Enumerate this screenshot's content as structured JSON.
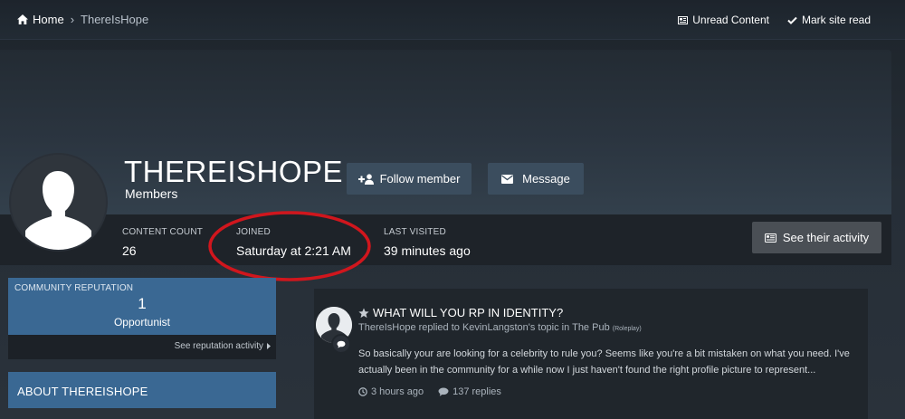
{
  "breadcrumb": {
    "home": "Home",
    "separator": "›",
    "current": "ThereIsHope"
  },
  "top_actions": {
    "unread": "Unread Content",
    "mark_read": "Mark site read"
  },
  "profile": {
    "username": "THEREISHOPE",
    "group": "Members",
    "follow_label": "Follow member",
    "message_label": "Message",
    "activity_label": "See their activity",
    "stats": {
      "content_count_label": "CONTENT COUNT",
      "content_count_value": "26",
      "joined_label": "JOINED",
      "joined_value": "Saturday at 2:21 AM",
      "last_visited_label": "LAST VISITED",
      "last_visited_value": "39 minutes ago"
    },
    "highlight_color": "#d0161d"
  },
  "reputation": {
    "title": "COMMUNITY REPUTATION",
    "value": "1",
    "rank": "Opportunist",
    "link": "See reputation activity"
  },
  "about": {
    "title": "ABOUT THEREISHOPE"
  },
  "activity": {
    "title": "WHAT WILL YOU RP IN IDENTITY?",
    "meta_main": "ThereIsHope replied to KevinLangston's topic in The Pub",
    "meta_small": "(Roleplay)",
    "snippet": "So basically your are looking for a celebrity to rule you? Seems like you're a bit mistaken on what you need. I've actually been in the community for a while now I just haven't found the right profile picture to represent...",
    "time": "3 hours ago",
    "replies": "137 replies"
  },
  "colors": {
    "accent_blue": "#3a6893",
    "button": "#3b4d5e",
    "activity_button": "#4a4f55",
    "background": "#1b2026"
  }
}
